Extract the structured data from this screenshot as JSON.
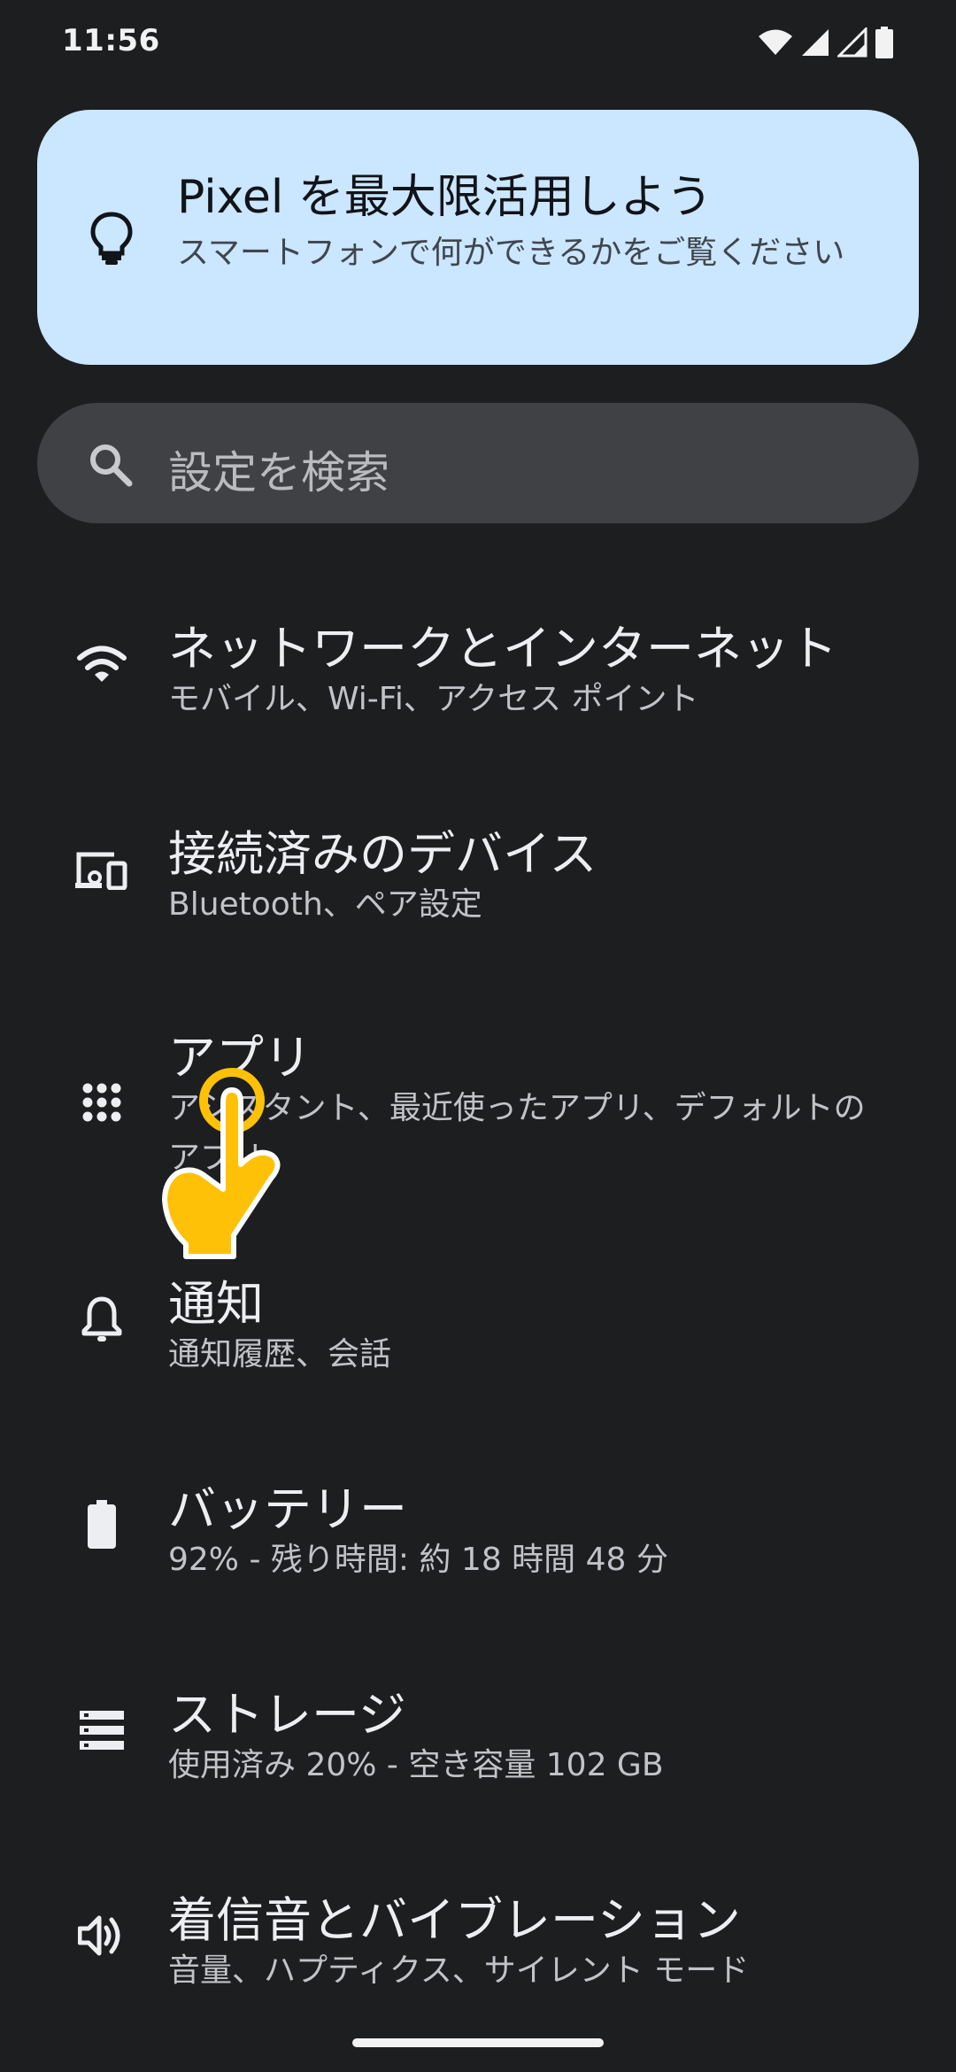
{
  "status_bar": {
    "time": "11:56",
    "icons": [
      "wifi-icon",
      "signal-icon",
      "signal-icon",
      "battery-icon"
    ]
  },
  "promo": {
    "title": "Pixel を最大限活用しよう",
    "subtitle": "スマートフォンで何ができるかをご覧ください",
    "icon": "lightbulb-icon"
  },
  "search": {
    "placeholder": "設定を検索",
    "icon": "search-icon"
  },
  "settings": {
    "items": [
      {
        "title": "ネットワークとインターネット",
        "subtitle": "モバイル、Wi-Fi、アクセス ポイント",
        "icon": "wifi-icon"
      },
      {
        "title": "接続済みのデバイス",
        "subtitle": "Bluetooth、ペア設定",
        "icon": "connected-devices-icon"
      },
      {
        "title": "アプリ",
        "subtitle": "アシスタント、最近使ったアプリ、デフォルトのアプリ",
        "icon": "apps-grid-icon"
      },
      {
        "title": "通知",
        "subtitle": "通知履歴、会話",
        "icon": "bell-icon"
      },
      {
        "title": "バッテリー",
        "subtitle": "92% - 残り時間: 約 18 時間 48 分",
        "icon": "battery-icon"
      },
      {
        "title": "ストレージ",
        "subtitle": "使用済み 20% - 空き容量 102 GB",
        "icon": "storage-icon"
      },
      {
        "title": "着信音とバイブレーション",
        "subtitle": "音量、ハプティクス、サイレント モード",
        "icon": "volume-icon"
      }
    ]
  },
  "colors": {
    "background": "#1d1e20",
    "promo_bg": "#cbe6ff",
    "search_bg": "#404144",
    "title_text": "#eceef1",
    "subtitle_text": "#c1c3c8",
    "tap_indicator": "#ffc107"
  }
}
